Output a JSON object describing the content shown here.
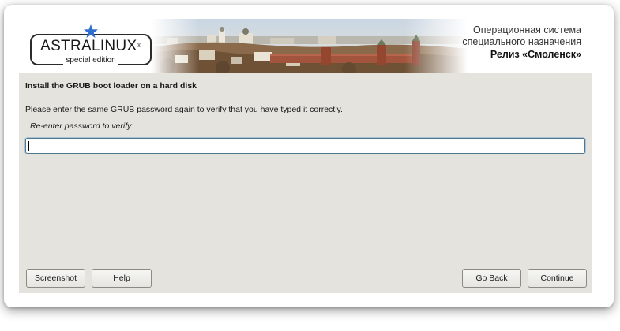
{
  "banner": {
    "logo_text": "ASTRALINUX",
    "logo_registered": "®",
    "logo_subtitle": "special edition",
    "os_line1": "Операционная система",
    "os_line2": "специального назначения",
    "release": "Релиз «Смоленск»",
    "accent_color": "#2f6fd0"
  },
  "page": {
    "section_title": "Install the GRUB boot loader on a hard disk",
    "description": "Please enter the same GRUB password again to verify that you have typed it correctly.",
    "field_label": "Re-enter password to verify:",
    "password_value": ""
  },
  "buttons": {
    "screenshot": "Screenshot",
    "help": "Help",
    "go_back": "Go Back",
    "continue": "Continue"
  }
}
